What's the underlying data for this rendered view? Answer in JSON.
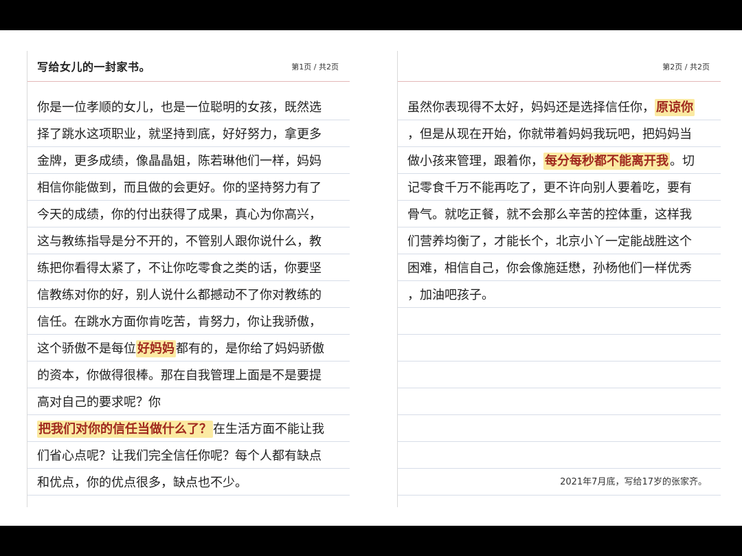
{
  "letter": {
    "title": "写给女儿的一封家书。",
    "page1_number": "第1页 / 共2页",
    "page2_number": "第2页 / 共2页",
    "signature": "2021年7月底，写给17岁的张家齐。",
    "page1_lines": [
      [
        "你是一位孝顺的女儿，也是一位聪明的女孩，既然选"
      ],
      [
        "择了跳水这项职业，就坚持到底，好好努力，拿更多"
      ],
      [
        "金牌，更多成绩，像晶晶姐，陈若琳他们一样，妈妈"
      ],
      [
        "相信你能做到，而且做的会更好。你的坚持努力有了"
      ],
      [
        "今天的成绩，你的付出获得了成果，真心为你高兴，"
      ],
      [
        "这与教练指导是分不开的，不管别人跟你说什么，教"
      ],
      [
        "练把你看得太紧了，不让你吃零食之类的话，你要坚"
      ],
      [
        "信教练对你的好，别人说什么都撼动不了你对教练的"
      ],
      [
        "信任。在跳水方面你肯吃苦，肯努力，你让我骄傲，"
      ],
      [
        "这个骄傲不是每位",
        "好妈妈",
        "都有的，是你给了妈妈骄傲"
      ],
      [
        "的资本，你做得很棒。那在自我管理上面是不是要提"
      ],
      [
        "高对自己的要求呢？你"
      ],
      [
        "",
        "把我们对你的信任当做什么了？",
        "在生活方面不能让我"
      ],
      [
        "们省心点呢？让我们完全信任你呢？每个人都有缺点"
      ],
      [
        "和优点，你的优点很多，缺点也不少。"
      ]
    ],
    "page2_lines": [
      [
        "虽然你表现得不太好，妈妈还是选择信任你，",
        "原谅你",
        ""
      ],
      [
        "，但是从现在开始，你就带着妈妈我玩吧，把妈妈当"
      ],
      [
        "做小孩来管理，跟着你，",
        "每分每秒都不能离开我",
        "。切"
      ],
      [
        "记零食千万不能再吃了，更不许向别人要着吃，要有"
      ],
      [
        "骨气。就吃正餐，就不会那么辛苦的控体重，这样我"
      ],
      [
        "们营养均衡了，才能长个，北京小丫一定能战胜这个"
      ],
      [
        "困难，相信自己，你会像施廷懋，孙杨他们一样优秀"
      ],
      [
        "，加油吧孩子。"
      ]
    ]
  },
  "colors": {
    "highlight_bg": "#fbeaa2",
    "highlight_text": "#a0291e",
    "rule_line": "#d7dde8",
    "header_rule": "#e4b7b7"
  }
}
